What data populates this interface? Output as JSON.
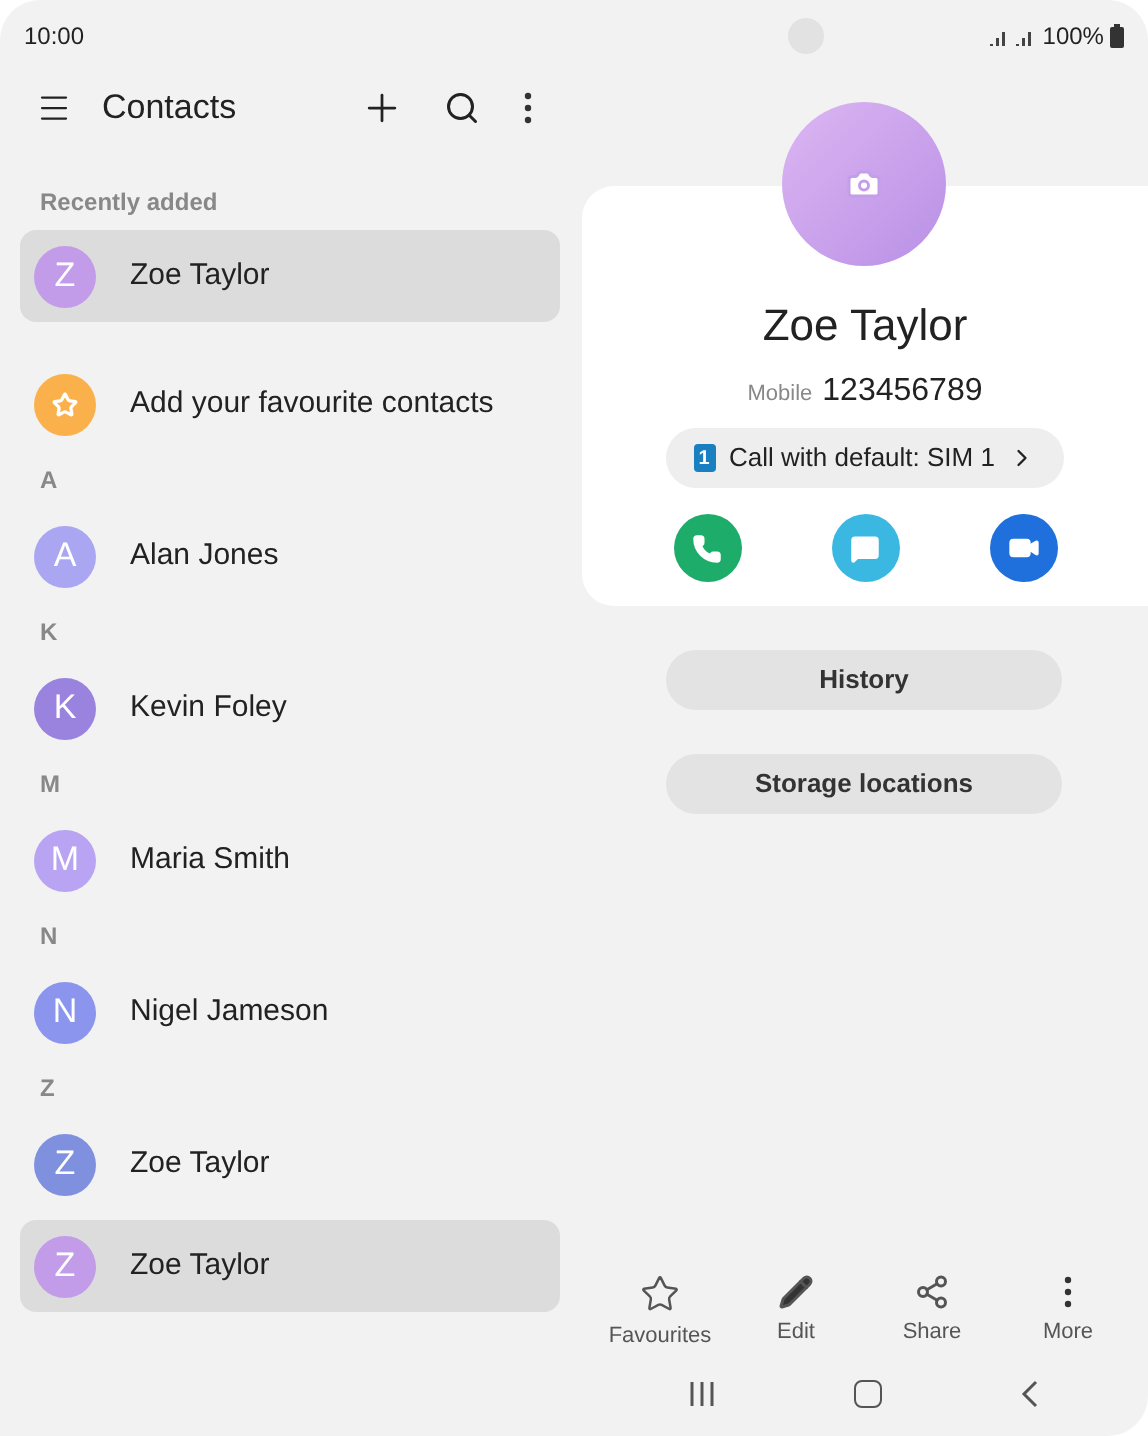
{
  "status_bar": {
    "time": "10:00",
    "battery": "100%"
  },
  "toolbar": {
    "title": "Contacts"
  },
  "list": [
    {
      "kind": "header",
      "label": "Recently added"
    },
    {
      "kind": "contact",
      "initial": "Z",
      "name": "Zoe Taylor",
      "selected": true,
      "color": "#c39ce9"
    },
    {
      "kind": "favourites",
      "label": "Add your favourite contacts"
    },
    {
      "kind": "header",
      "label": "A"
    },
    {
      "kind": "contact",
      "initial": "A",
      "name": "Alan Jones",
      "selected": false,
      "color": "#aaa6f2"
    },
    {
      "kind": "header",
      "label": "K"
    },
    {
      "kind": "contact",
      "initial": "K",
      "name": "Kevin Foley",
      "selected": false,
      "color": "#9a82df"
    },
    {
      "kind": "header",
      "label": "M"
    },
    {
      "kind": "contact",
      "initial": "M",
      "name": "Maria Smith",
      "selected": false,
      "color": "#b8a4f2"
    },
    {
      "kind": "header",
      "label": "N"
    },
    {
      "kind": "contact",
      "initial": "N",
      "name": "Nigel Jameson",
      "selected": false,
      "color": "#8b95ee"
    },
    {
      "kind": "header",
      "label": "Z"
    },
    {
      "kind": "contact",
      "initial": "Z",
      "name": "Zoe Taylor",
      "selected": false,
      "color": "#7f90df"
    },
    {
      "kind": "contact",
      "initial": "Z",
      "name": "Zoe Taylor",
      "selected": true,
      "color": "#c39ce9"
    }
  ],
  "detail": {
    "name": "Zoe Taylor",
    "number_label": "Mobile",
    "number": "123456789",
    "sim_badge": "1",
    "default_call": "Call with default: SIM 1",
    "buttons": [
      "History",
      "Storage locations"
    ]
  },
  "bottom_actions": [
    {
      "kind": "star",
      "label": "Favourites"
    },
    {
      "kind": "edit",
      "label": "Edit"
    },
    {
      "kind": "share",
      "label": "Share"
    },
    {
      "kind": "more",
      "label": "More"
    }
  ]
}
